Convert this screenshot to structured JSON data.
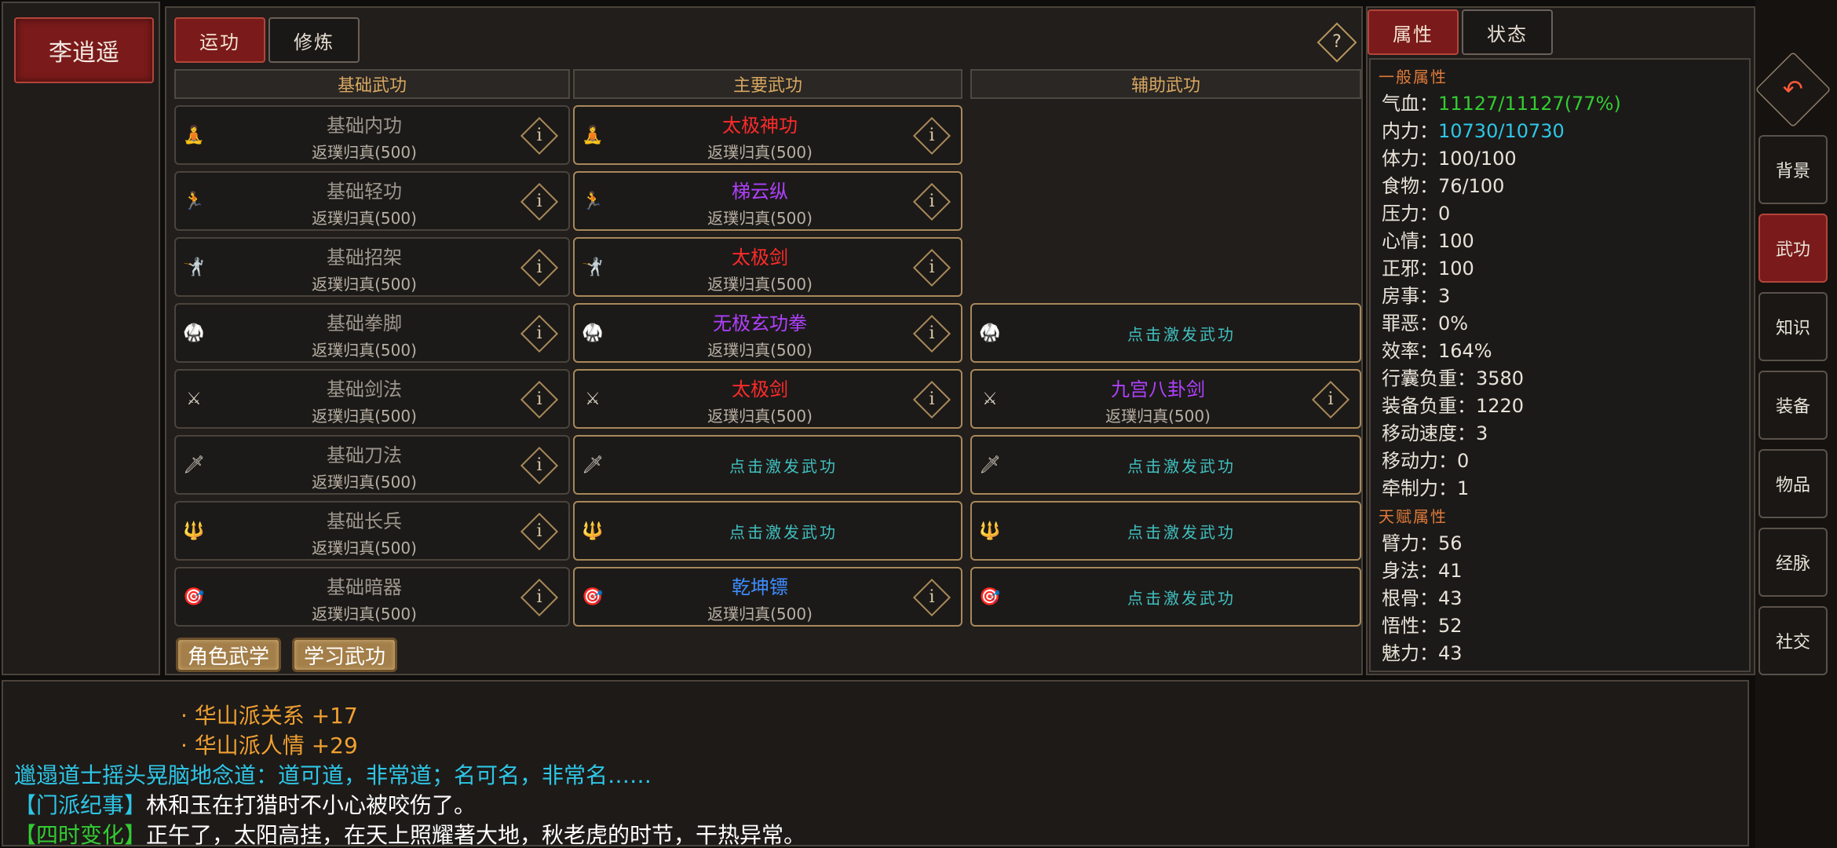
{
  "character": {
    "name": "李逍遥"
  },
  "tabs": {
    "active": "运功",
    "inactive": "修炼",
    "help": "?"
  },
  "columns": {
    "basic": "基础武功",
    "main": "主要武功",
    "aux": "辅助武功"
  },
  "basic_skills": [
    {
      "icon": "🧘",
      "name": "基础内功",
      "sub": "返璞归真(500)"
    },
    {
      "icon": "🏃",
      "name": "基础轻功",
      "sub": "返璞归真(500)"
    },
    {
      "icon": "🤺",
      "name": "基础招架",
      "sub": "返璞归真(500)"
    },
    {
      "icon": "🥋",
      "name": "基础拳脚",
      "sub": "返璞归真(500)"
    },
    {
      "icon": "⚔",
      "name": "基础剑法",
      "sub": "返璞归真(500)"
    },
    {
      "icon": "🗡",
      "name": "基础刀法",
      "sub": "返璞归真(500)"
    },
    {
      "icon": "🔱",
      "name": "基础长兵",
      "sub": "返璞归真(500)"
    },
    {
      "icon": "🎯",
      "name": "基础暗器",
      "sub": "返璞归真(500)"
    }
  ],
  "main_skills": [
    {
      "icon": "🧘",
      "name": "太极神功",
      "sub": "返璞归真(500)",
      "color": "#ff2a2a"
    },
    {
      "icon": "🏃",
      "name": "梯云纵",
      "sub": "返璞归真(500)",
      "color": "#b040ff"
    },
    {
      "icon": "🤺",
      "name": "太极剑",
      "sub": "返璞归真(500)",
      "color": "#ff2a2a"
    },
    {
      "icon": "🥋",
      "name": "无极玄功拳",
      "sub": "返璞归真(500)",
      "color": "#b040ff"
    },
    {
      "icon": "⚔",
      "name": "太极剑",
      "sub": "返璞归真(500)",
      "color": "#ff2a2a"
    },
    {
      "icon": "🗡",
      "activate": "点击激发武功"
    },
    {
      "icon": "🔱",
      "activate": "点击激发武功"
    },
    {
      "icon": "🎯",
      "name": "乾坤镖",
      "sub": "返璞归真(500)",
      "color": "#3d8cff"
    }
  ],
  "aux_skills": [
    {
      "icon": "🥋",
      "activate": "点击激发武功"
    },
    {
      "icon": "⚔",
      "name": "九宫八卦剑",
      "sub": "返璞归真(500)",
      "color": "#b040ff"
    },
    {
      "icon": "🗡",
      "activate": "点击激发武功"
    },
    {
      "icon": "🔱",
      "activate": "点击激发武功"
    },
    {
      "icon": "🎯",
      "activate": "点击激发武功"
    }
  ],
  "info_glyph": "i",
  "buttons": {
    "char_martial": "角色武学",
    "learn_martial": "学习武功"
  },
  "attr_tabs": {
    "active": "属性",
    "inactive": "状态"
  },
  "attributes": {
    "general_title": "一般属性",
    "general": [
      {
        "label": "气血：",
        "value": "11127/11127(77%)",
        "color": "#33cc33"
      },
      {
        "label": "内力：",
        "value": "10730/10730",
        "color": "#2ec6e6"
      },
      {
        "label": "体力：",
        "value": "100/100"
      },
      {
        "label": "食物：",
        "value": "76/100"
      },
      {
        "label": "压力：",
        "value": "0"
      },
      {
        "label": "心情：",
        "value": "100"
      },
      {
        "label": "正邪：",
        "value": "100"
      },
      {
        "label": "房事：",
        "value": "3"
      },
      {
        "label": "罪恶：",
        "value": "0%"
      },
      {
        "label": "效率：",
        "value": "164%"
      },
      {
        "label": "行囊负重：",
        "value": "3580"
      },
      {
        "label": "装备负重：",
        "value": "1220"
      },
      {
        "label": "移动速度：",
        "value": "3"
      },
      {
        "label": "移动力：",
        "value": "0"
      },
      {
        "label": "牵制力：",
        "value": "1"
      }
    ],
    "talent_title": "天赋属性",
    "talent": [
      {
        "label": "臂力：",
        "value": "56"
      },
      {
        "label": "身法：",
        "value": "41"
      },
      {
        "label": "根骨：",
        "value": "43"
      },
      {
        "label": "悟性：",
        "value": "52"
      },
      {
        "label": "魅力：",
        "value": "43"
      }
    ]
  },
  "nav": {
    "back_icon": "↶",
    "items": [
      "背景",
      "武功",
      "知识",
      "装备",
      "物品",
      "经脉",
      "社交"
    ],
    "active": "武功"
  },
  "log": [
    {
      "text": "· 华山派关系 +17",
      "color": "#f0a030"
    },
    {
      "text": "· 华山派人情 +29",
      "color": "#f0a030"
    },
    {
      "text": "邋遢道士摇头晃脑地念道：道可道，非常道；名可名，非常名……",
      "color": "#2ec6e6"
    },
    {
      "tag": "【门派纪事】",
      "text": "林和玉在打猎时不小心被咬伤了。",
      "tagcolor": "#2ec6e6",
      "color": "#ffffff"
    },
    {
      "tag": "【四时变化】",
      "text": "正午了，太阳高挂，在天上照耀著大地，秋老虎的时节，干热异常。",
      "tagcolor": "#33cc33",
      "color": "#ffffff"
    }
  ]
}
